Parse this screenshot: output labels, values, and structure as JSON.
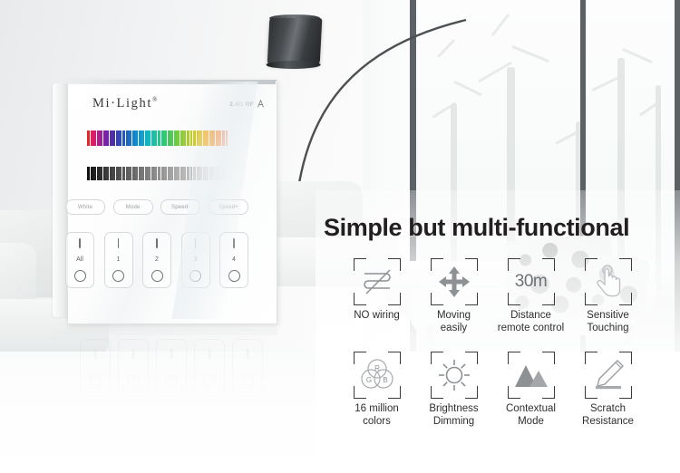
{
  "scene": {
    "name": "modern-living-room",
    "description": "White living room with arc floor lamp, window wall and chaise lounge"
  },
  "device": {
    "name": "Mi-Light smart touch panel",
    "brand": "Mi·Light",
    "brand_registered": "®",
    "rf_label": "2.4G RF",
    "rf_icon": "signal-antenna-icon",
    "color_slider": {
      "name": "rgb-color-touch-slider",
      "segments": 44,
      "colors": [
        "#e8232a",
        "#e01f55",
        "#cf1f75",
        "#b51d86",
        "#9b219b",
        "#8022a0",
        "#6b27a7",
        "#5a2ca9",
        "#4733a8",
        "#3a3fae",
        "#2f4cb4",
        "#2558b8",
        "#1f65bd",
        "#1a73c2",
        "#1680c6",
        "#128dc9",
        "#1099cb",
        "#0fa5cb",
        "#10b0c6",
        "#13b9ba",
        "#17bfae",
        "#1dc39f",
        "#24c58f",
        "#2dc67f",
        "#38c76f",
        "#45c861",
        "#55c954",
        "#66ca4a",
        "#78cb41",
        "#8acc3a",
        "#9ccd35",
        "#aecd31",
        "#bfcd2f",
        "#cfcb2e",
        "#ddc62d",
        "#e8bf2c",
        "#f0b62b",
        "#f4ab29",
        "#f69f27",
        "#f69225",
        "#f58423",
        "#f37621",
        "#f0691f",
        "#ec5c1d"
      ]
    },
    "brightness_slider": {
      "name": "brightness-touch-slider",
      "segments": 44,
      "from": "#111111",
      "to": "#f4f4f4"
    },
    "function_buttons": [
      {
        "name": "white-button",
        "label": "White"
      },
      {
        "name": "mode-button",
        "label": "Mode"
      },
      {
        "name": "speed-down-button",
        "label": "Speed-"
      },
      {
        "name": "speed-up-button",
        "label": "Speed+"
      }
    ],
    "zone_buttons": [
      {
        "name": "zone-all-button",
        "label": "All",
        "on_glyph": "I",
        "off_glyph": "O"
      },
      {
        "name": "zone-1-button",
        "label": "1",
        "on_glyph": "I",
        "off_glyph": "O"
      },
      {
        "name": "zone-2-button",
        "label": "2",
        "on_glyph": "I",
        "off_glyph": "O"
      },
      {
        "name": "zone-3-button",
        "label": "3",
        "on_glyph": "I",
        "off_glyph": "O"
      },
      {
        "name": "zone-4-button",
        "label": "4",
        "on_glyph": "I",
        "off_glyph": "O"
      }
    ]
  },
  "headline": "Simple but multi-functional",
  "features": [
    {
      "name": "feature-no-wiring",
      "icon": "no-wiring-crossed-icon",
      "label": "NO wiring",
      "label_line1": "NO wiring",
      "label_line2": ""
    },
    {
      "name": "feature-moving-easily",
      "icon": "four-way-arrow-icon",
      "label": "Moving easily",
      "label_line1": "Moving",
      "label_line2": "easily"
    },
    {
      "name": "feature-distance",
      "icon": "distance-30m-text-icon",
      "label": "Distance remote control",
      "label_line1": "Distance",
      "label_line2": "remote control",
      "value": "30m"
    },
    {
      "name": "feature-sensitive-touch",
      "icon": "hand-touch-icon",
      "label": "Sensitive Touching",
      "label_line1": "Sensitive",
      "label_line2": "Touching"
    },
    {
      "name": "feature-16-million",
      "icon": "rgb-venn-circles-icon",
      "label": "16 million colors",
      "label_line1": "16 million",
      "label_line2": "colors",
      "rgb_letters": [
        "R",
        "G",
        "B"
      ]
    },
    {
      "name": "feature-brightness",
      "icon": "sun-brightness-icon",
      "label": "Brightness Dimming",
      "label_line1": "Brightness",
      "label_line2": "Dimming"
    },
    {
      "name": "feature-contextual",
      "icon": "mountains-scene-icon",
      "label": "Contextual Mode",
      "label_line1": "Contextual",
      "label_line2": "Mode"
    },
    {
      "name": "feature-scratch",
      "icon": "pen-scratch-icon",
      "label": "Scratch Resistance",
      "label_line1": "Scratch",
      "label_line2": "Resistance"
    }
  ],
  "colors": {
    "headline": "#231f20",
    "label": "#2f2f2f",
    "icon_stroke": "#7c8083",
    "frame": "#3b3b3b"
  }
}
